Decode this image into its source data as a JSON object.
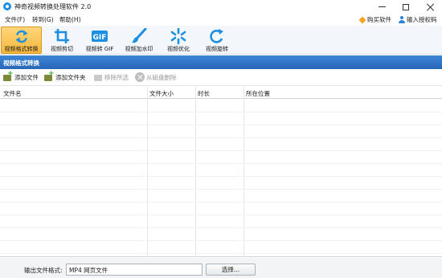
{
  "window": {
    "title": "神奇视频转换处理软件 2.0"
  },
  "menu": {
    "file": "文件(F)",
    "goto": "转到(G)",
    "help": "帮助(H)",
    "buy": "购买软件",
    "auth": "输入授权码"
  },
  "toolbar": {
    "items": [
      {
        "label": "视频格式转换",
        "icon": "convert-icon",
        "active": true
      },
      {
        "label": "视频剪切",
        "icon": "crop-icon",
        "active": false
      },
      {
        "label": "视频转 GIF",
        "icon": "gif-icon",
        "active": false
      },
      {
        "label": "视频加水印",
        "icon": "brush-icon",
        "active": false
      },
      {
        "label": "视频优化",
        "icon": "optimize-icon",
        "active": false
      },
      {
        "label": "视频旋转",
        "icon": "rotate-icon",
        "active": false
      }
    ]
  },
  "section": {
    "title": "视频格式转换"
  },
  "actions": {
    "add_file": "添加文件",
    "add_folder": "添加文件夹",
    "remove_selected": "移除所选",
    "delete_from_disk": "从磁盘删除"
  },
  "table": {
    "columns": [
      "文件名",
      "文件大小",
      "时长",
      "所在位置"
    ],
    "rows": []
  },
  "output": {
    "label": "输出文件格式:",
    "value": "MP4 网页文件",
    "select_button": "选择..."
  },
  "colors": {
    "accent": "#2766b8",
    "active_tool": "#f5b73b",
    "icon_blue": "#1d8fe0"
  }
}
